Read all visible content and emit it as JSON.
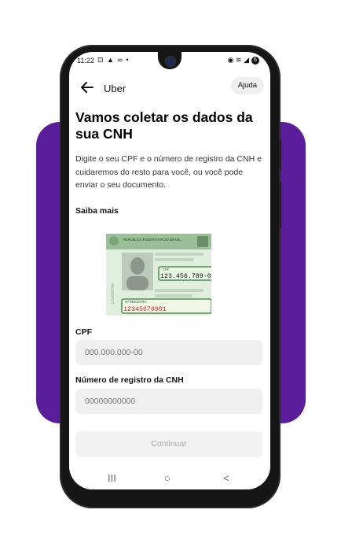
{
  "status_bar": {
    "time": "11:22",
    "left_icons": "⊡ ▲ ∞ •",
    "right_icons": "◉ ≋ ◢",
    "battery": "6"
  },
  "header": {
    "title": "Uber",
    "help_label": "Ajuda"
  },
  "main": {
    "title": "Vamos coletar os dados da sua CNH",
    "description": "Digite o seu CPF e o número de registro da CNH e cuidaremos do resto para você, ou você pode enviar o seu documento.",
    "learn_more": "Saiba mais"
  },
  "card": {
    "header": "REPÚBLICA FEDERATIVA DO BRASIL",
    "cpf_tag": "CPF",
    "cpf_value": "123.456.789-01",
    "registro_tag": "Nº REGISTRO",
    "registro_value": "12345678901",
    "side_number": "123456789"
  },
  "form": {
    "cpf_label": "CPF",
    "cpf_placeholder": "000.000.000-00",
    "cnh_label": "Número de registro da CNH",
    "cnh_placeholder": "00000000000",
    "continue_label": "Continuar"
  },
  "nav": {
    "recent": "III",
    "home": "○",
    "back": "<"
  },
  "colors": {
    "accent_purple": "#5b1e9b",
    "card_green": "#2e7d32",
    "registro_red": "#c62828"
  }
}
